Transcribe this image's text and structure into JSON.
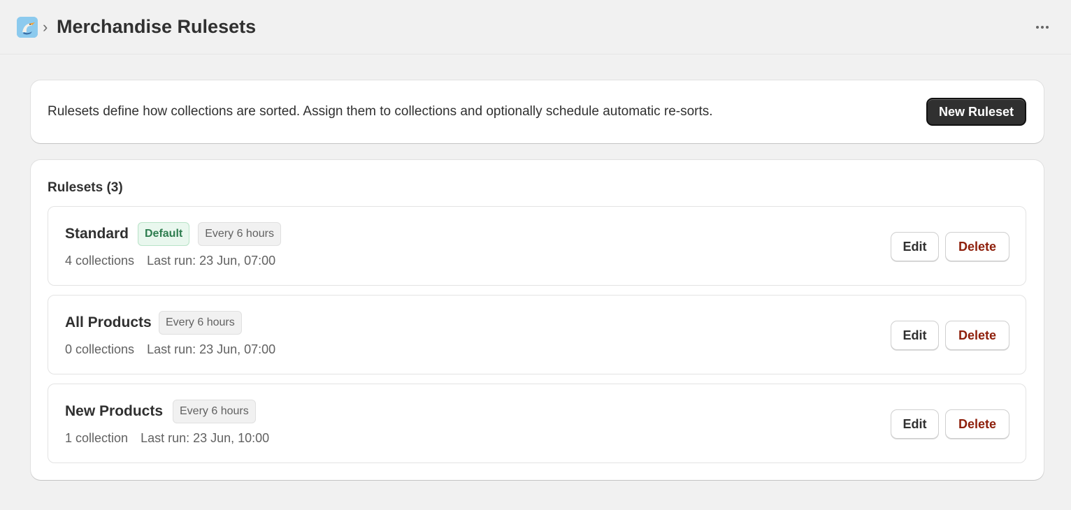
{
  "header": {
    "breadcrumb_separator": "›",
    "title": "Merchandise Rulesets",
    "app_icon": "pelican-app-icon",
    "more_icon": "more-horizontal-icon"
  },
  "intro": {
    "text": "Rulesets define how collections are sorted. Assign them to collections and optionally schedule automatic re-sorts.",
    "new_button_label": "New Ruleset"
  },
  "list": {
    "heading": "Rulesets (3)",
    "rows": [
      {
        "name": "Standard",
        "default_badge": "Default",
        "schedule_badge": "Every 6 hours",
        "collections": "4 collections",
        "last_run": "Last run: 23 Jun, 07:00",
        "edit_label": "Edit",
        "delete_label": "Delete"
      },
      {
        "name": "All Products",
        "default_badge": "",
        "schedule_badge": "Every 6 hours",
        "collections": "0 collections",
        "last_run": "Last run: 23 Jun, 07:00",
        "edit_label": "Edit",
        "delete_label": "Delete"
      },
      {
        "name": "New Products",
        "default_badge": "",
        "schedule_badge": "Every 6 hours",
        "collections": "1 collection",
        "last_run": "Last run: 23 Jun, 10:00",
        "edit_label": "Edit",
        "delete_label": "Delete"
      }
    ]
  },
  "colors": {
    "background": "#f1f1f1",
    "primary_button": "#303030",
    "delete_text": "#8e1f0b",
    "default_badge_text": "#2e7d4f",
    "default_badge_bg": "#e9f7ee"
  }
}
